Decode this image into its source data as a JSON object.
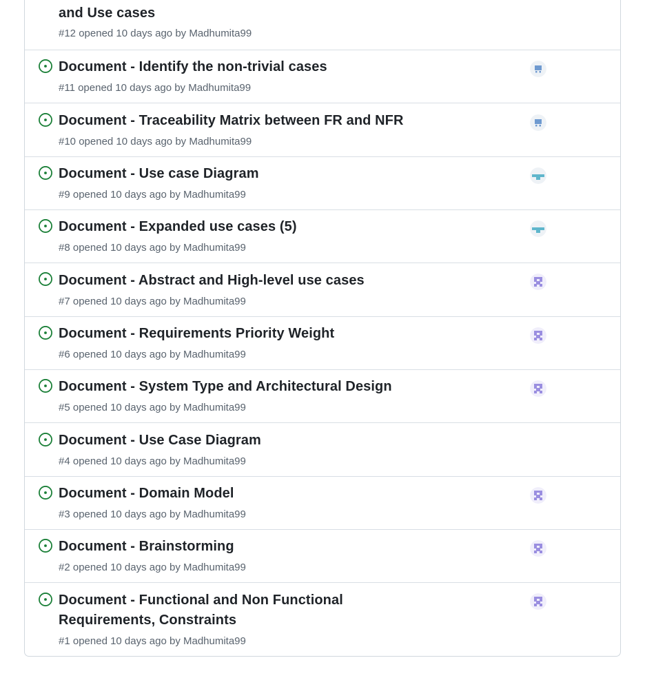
{
  "colors": {
    "open_icon": "#1a7f37",
    "title": "#1f2328",
    "meta": "#59636e",
    "border": "#d0d7de"
  },
  "issues": [
    {
      "title": "and Use cases",
      "meta": "#12 opened 10 days ago by Madhumita99",
      "assignee": "none",
      "open_icon": false
    },
    {
      "title": "Document - Identify the non-trivial cases",
      "meta": "#11 opened 10 days ago by Madhumita99",
      "assignee": "robot-avatar-icon",
      "open_icon": true
    },
    {
      "title": "Document - Traceability Matrix between FR and NFR",
      "meta": "#10 opened 10 days ago by Madhumita99",
      "assignee": "robot-avatar-icon",
      "open_icon": true
    },
    {
      "title": "Document - Use case Diagram",
      "meta": "#9 opened 10 days ago by Madhumita99",
      "assignee": "teal-avatar-icon",
      "open_icon": true
    },
    {
      "title": "Document - Expanded use cases (5)",
      "meta": "#8 opened 10 days ago by Madhumita99",
      "assignee": "teal-avatar-icon",
      "open_icon": true
    },
    {
      "title": "Document - Abstract and High-level use cases",
      "meta": "#7 opened 10 days ago by Madhumita99",
      "assignee": "identicon-avatar-icon",
      "open_icon": true
    },
    {
      "title": "Document - Requirements Priority Weight",
      "meta": "#6 opened 10 days ago by Madhumita99",
      "assignee": "identicon-avatar-icon",
      "open_icon": true
    },
    {
      "title": "Document - System Type and Architectural Design",
      "meta": "#5 opened 10 days ago by Madhumita99",
      "assignee": "identicon-avatar-icon",
      "open_icon": true
    },
    {
      "title": "Document - Use Case Diagram",
      "meta": "#4 opened 10 days ago by Madhumita99",
      "assignee": "none",
      "open_icon": true
    },
    {
      "title": "Document - Domain Model",
      "meta": "#3 opened 10 days ago by Madhumita99",
      "assignee": "identicon-avatar-icon",
      "open_icon": true
    },
    {
      "title": "Document - Brainstorming",
      "meta": "#2 opened 10 days ago by Madhumita99",
      "assignee": "identicon-avatar-icon",
      "open_icon": true
    },
    {
      "title": "Document - Functional and Non Functional Requirements, Constraints",
      "meta": "#1 opened 10 days ago by Madhumita99",
      "assignee": "identicon-avatar-icon",
      "open_icon": true
    }
  ]
}
